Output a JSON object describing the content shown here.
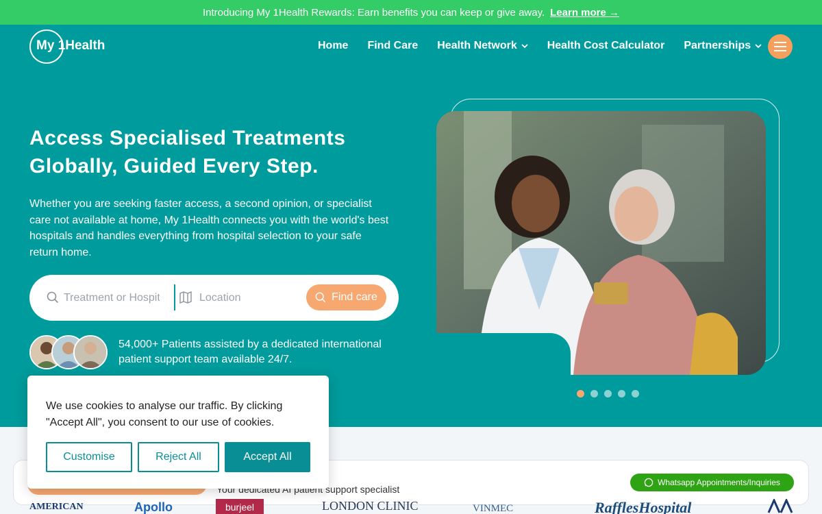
{
  "announcement": {
    "text": "Introducing My 1Health Rewards: Earn benefits you can keep or give away.",
    "link": "Learn more →"
  },
  "header": {
    "logo_text": "My 1Health",
    "nav": [
      {
        "label": "Home"
      },
      {
        "label": "Find Care"
      },
      {
        "label": "Health Network",
        "has_dropdown": true
      },
      {
        "label": "Health Cost Calculator"
      },
      {
        "label": "Partnerships",
        "has_dropdown": true
      }
    ],
    "menu_icon": "hamburger-icon"
  },
  "hero": {
    "title_line1": "Access Specialised Treatments",
    "title_line2": "Globally, Guided Every Step.",
    "description": "Whether you are seeking faster access, a second opinion, or specialist care not available at home, My 1Health connects you with the world's best hospitals and handles everything from hospital selection to your safe return home.",
    "search": {
      "treatment_placeholder": "Treatment or Hospital",
      "location_placeholder": "Location",
      "button_label": "Find care"
    },
    "patients_text": "54,000+ Patients assisted by a dedicated international patient support team available 24/7.",
    "carousel": {
      "slides": 5,
      "active": 1
    }
  },
  "lower": {
    "ai_text": "Your dedicated AI patient support specialist",
    "whatsapp_label": "Whatsapp Appointments/Inquiries",
    "hospital_logos": [
      "AMERICAN",
      "Apollo",
      "burjeel",
      "LONDON CLINIC",
      "VINMEC",
      "RafflesHospital"
    ]
  },
  "cookie": {
    "text": "We use cookies to analyse our traffic. By clicking \"Accept All\", you consent to our use of cookies.",
    "customise": "Customise",
    "reject": "Reject All",
    "accept": "Accept All"
  },
  "colors": {
    "teal": "#009b9c",
    "green_bar": "#33cc66",
    "orange": "#f7a871",
    "whatsapp": "#2ea313"
  }
}
